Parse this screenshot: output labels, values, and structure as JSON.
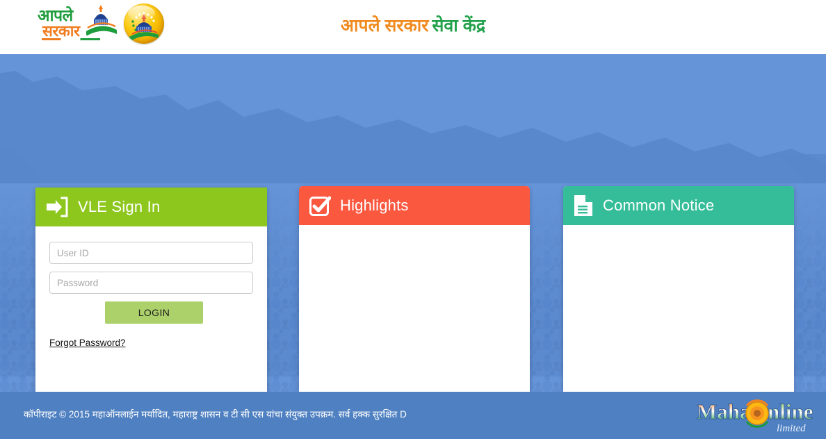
{
  "header": {
    "logo_wordmark_top": "आपले",
    "logo_wordmark_bottom": "सरकार",
    "logo_alt": "aaple-sarkar-logo",
    "emblem_alt": "aaple-sarkar-emblem",
    "title_primary": "आपले सरकार",
    "title_secondary": "सेवा केंद्र"
  },
  "signin": {
    "panel_title": "VLE Sign In",
    "icon": "sign-in-icon",
    "header_color": "#8DC71E",
    "userid_placeholder": "User ID",
    "userid_value": "",
    "password_placeholder": "Password",
    "password_value": "",
    "login_label": "LOGIN",
    "login_color": "#ACD16B",
    "forgot_label": "Forgot Password?"
  },
  "highlights": {
    "panel_title": "Highlights",
    "icon": "checkbox-check-icon",
    "header_color": "#FB5840",
    "items": []
  },
  "notice": {
    "panel_title": "Common Notice",
    "icon": "document-icon",
    "header_color": "#34BD98",
    "items": []
  },
  "background": {
    "body_color": "#6694D8",
    "map_alt": "india-map-silhouette",
    "crowd_alt": "crowd-photo-overlay"
  },
  "footer": {
    "copyright": "कॉपीराइट © 2015 महाऑनलाईन मर्यादित, महाराष्ट्र शासन व टी सी एस यांचा संयुक्त उपक्रम. सर्व हक्क सुरक्षित D",
    "bar_color": "#4F80C1",
    "logo_main": "MahaOnline",
    "logo_sub": "limited"
  }
}
